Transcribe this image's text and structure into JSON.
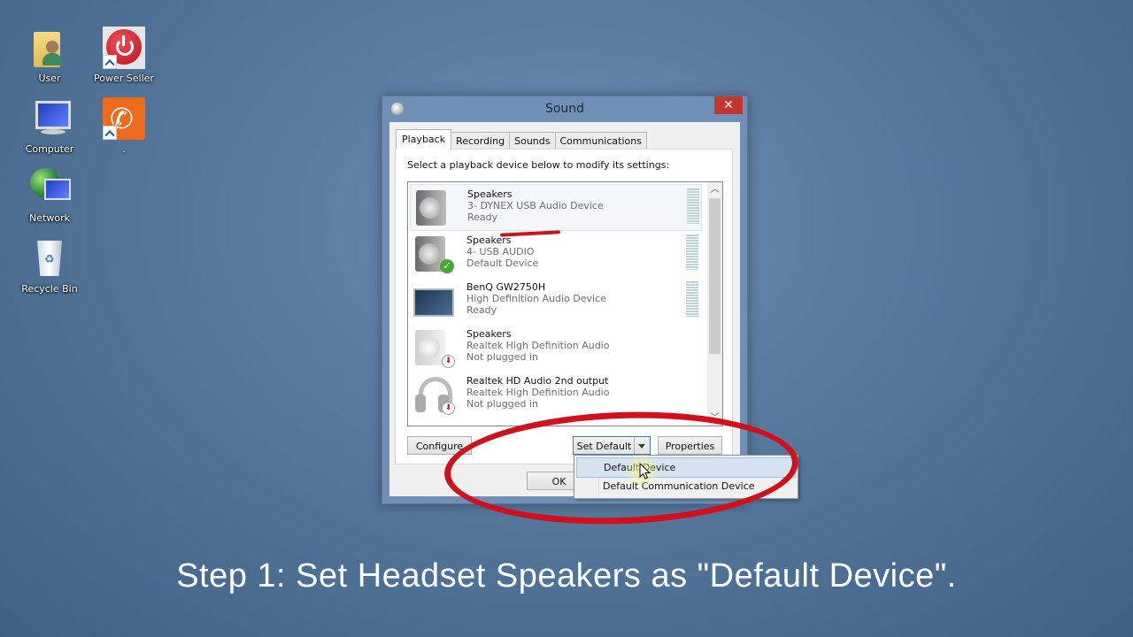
{
  "desktop": {
    "icons": [
      {
        "label": "User"
      },
      {
        "label": "Power Seller"
      },
      {
        "label": "Computer"
      },
      {
        "label": "."
      },
      {
        "label": "Network"
      },
      {
        "label": "Recycle Bin"
      }
    ]
  },
  "dialog": {
    "title": "Sound",
    "close_label": "✕",
    "tabs": [
      {
        "label": "Playback",
        "active": true
      },
      {
        "label": "Recording"
      },
      {
        "label": "Sounds"
      },
      {
        "label": "Communications"
      }
    ],
    "instruction": "Select a playback device below to modify its settings:",
    "devices": [
      {
        "name": "Speakers",
        "description": "3- DYNEX USB Audio Device",
        "status": "Ready",
        "icon": "speaker-icon",
        "selected": true
      },
      {
        "name": "Speakers",
        "description": "4- USB  AUDIO",
        "status": "Default Device",
        "icon": "speaker-icon",
        "badge": "check"
      },
      {
        "name": "BenQ GW2750H",
        "description": "High Definition Audio Device",
        "status": "Ready",
        "icon": "monitor-icon"
      },
      {
        "name": "Speakers",
        "description": "Realtek High Definition Audio",
        "status": "Not plugged in",
        "icon": "speaker-icon",
        "badge": "unplugged"
      },
      {
        "name": "Realtek HD Audio 2nd output",
        "description": "Realtek High Definition Audio",
        "status": "Not plugged in",
        "icon": "headphones-icon",
        "badge": "unplugged"
      }
    ],
    "buttons": {
      "configure": "Configure",
      "set_default": "Set Default",
      "properties": "Properties",
      "ok": "OK"
    },
    "set_default_menu": [
      {
        "label": "Default Device",
        "hover": true
      },
      {
        "label": "Default Communication Device"
      }
    ]
  },
  "caption": "Step 1: Set Headset Speakers as \"Default Device\".",
  "colors": {
    "annotation_red": "#d0101a",
    "close_button": "#c7352f",
    "desktop_blue": "#56789d"
  }
}
